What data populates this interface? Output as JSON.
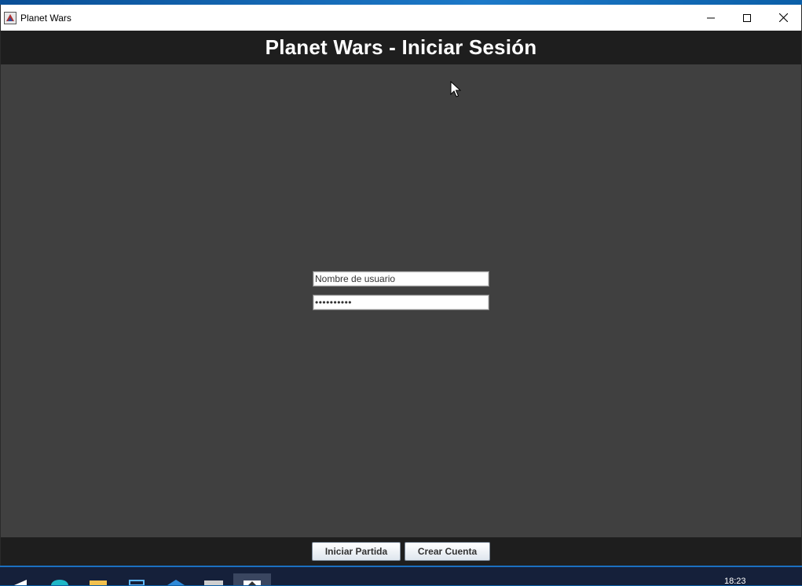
{
  "window": {
    "title": "Planet Wars"
  },
  "header": {
    "title": "Planet Wars - Iniciar Sesión"
  },
  "login": {
    "username_value": "Nombre de usuario",
    "password_value": "••••••••••"
  },
  "footer": {
    "start_label": "Iniciar Partida",
    "create_label": "Crear Cuenta"
  },
  "taskbar": {
    "clock": "18:23"
  },
  "colors": {
    "background": "#404040",
    "bars": "#1e1e1e",
    "header_text": "#ffffff"
  }
}
